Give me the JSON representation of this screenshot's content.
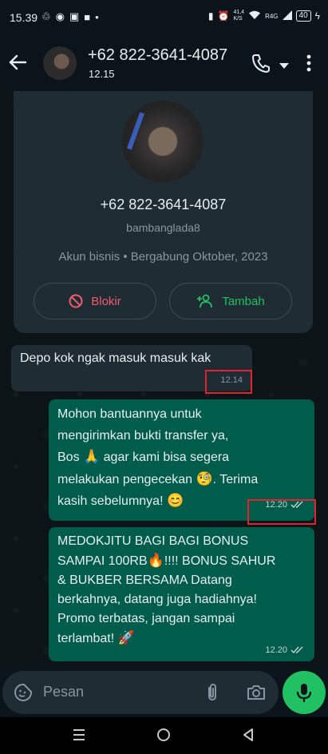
{
  "status_bar": {
    "time": "15.39",
    "net_speed_top": "41,4",
    "net_speed_bottom": "K/S",
    "signal": "R4G",
    "battery": "40"
  },
  "header": {
    "title": "+62 822-3641-4087",
    "subtitle": "12.15"
  },
  "profile_card": {
    "phone": "+62 822-3641-4087",
    "username": "bambanglada8",
    "info": "Akun bisnis • Bergabung Oktober, 2023",
    "block_label": "Blokir",
    "add_label": "Tambah"
  },
  "messages": [
    {
      "direction": "incoming",
      "text": "Depo kok ngak masuk masuk kak",
      "time": "12.14"
    },
    {
      "direction": "outgoing",
      "line1": "Mohon bantuannya untuk",
      "line2": "mengirimkan bukti transfer ya,",
      "line3a": "Bos",
      "line3b": "agar kami bisa segera",
      "line4a": "melakukan pengecekan",
      "line4b": ". Terima",
      "line5": "kasih sebelumnya!",
      "time": "12.20"
    },
    {
      "direction": "outgoing",
      "line1": "MEDOKJITU BAGI BAGI BONUS",
      "line2a": "SAMPAI 100RB",
      "line2b": "!!!! BONUS SAHUR",
      "line3": "& BUKBER BERSAMA Datang",
      "line4": "berkahnya, datang juga hadiahnya!",
      "line5": "Promo terbatas, jangan sampai",
      "line6": "terlambat!",
      "time": "12.20"
    }
  ],
  "input": {
    "placeholder": "Pesan"
  },
  "emoji": {
    "pray": "🙏",
    "monocle": "🧐",
    "smile": "😊",
    "fire": "🔥",
    "rocket": "🚀"
  },
  "colors": {
    "incoming_bubble": "#1f2c34",
    "outgoing_bubble": "#005c4b",
    "accent_green": "#21c063",
    "block_red": "#f15c6d",
    "highlight_red": "#e3222d"
  }
}
